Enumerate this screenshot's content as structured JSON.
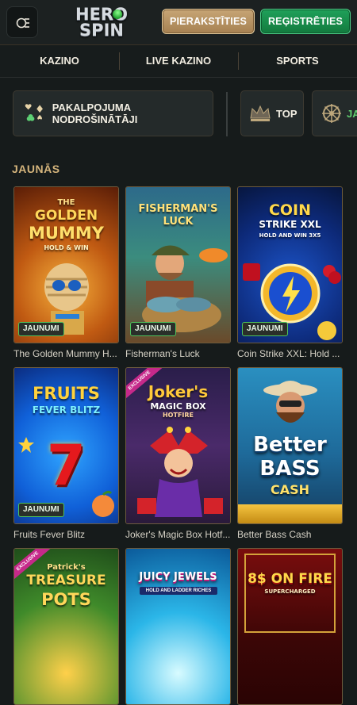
{
  "header": {
    "login_label": "PIERAKSTĪTIES",
    "register_label": "REĢISTRĒTIES",
    "logo_line1": "HERO",
    "logo_line2": "SPIN"
  },
  "nav": {
    "items": [
      {
        "label": "KAZINO"
      },
      {
        "label": "LIVE KAZINO"
      },
      {
        "label": "SPORTS"
      }
    ]
  },
  "categories": [
    {
      "label": "PAKALPOJUMA NODROŠINĀTĀJI",
      "icon": "cards-icon"
    },
    {
      "label": "TOP",
      "icon": "crown-icon"
    },
    {
      "label": "JA",
      "icon": "wheel-icon"
    }
  ],
  "section": {
    "title": "JAUNĀS"
  },
  "badge_new": "JAUNUMI",
  "games": [
    {
      "title": "The Golden Mummy H...",
      "art_line1": "THE",
      "art_line2": "GOLDEN",
      "art_line3": "MUMMY",
      "art_line4": "HOLD & WIN",
      "new": true
    },
    {
      "title": "Fisherman's Luck",
      "art_line1": "FISHERMAN'S",
      "art_line2": "LUCK",
      "new": true
    },
    {
      "title": "Coin Strike XXL: Hold ...",
      "art_line1": "COIN",
      "art_line2": "STRIKE XXL",
      "art_line3": "HOLD AND WIN 3X5",
      "new": true
    },
    {
      "title": "Fruits Fever Blitz",
      "art_line1": "FRUITS",
      "art_line2": "FEVER BLITZ",
      "art_line3": "7",
      "new": true
    },
    {
      "title": "Joker's Magic Box Hotf...",
      "art_line1": "Joker's",
      "art_line2": "MAGIC BOX",
      "art_line3": "HOTFIRE",
      "ribbon": "EXCLUSIVE",
      "new": false
    },
    {
      "title": "Better Bass Cash",
      "art_line1": "Better",
      "art_line2": "BASS",
      "art_line3": "CASH",
      "new": false
    },
    {
      "title": "",
      "art_line1": "Patrick's",
      "art_line2": "TREASURE",
      "art_line3": "POTS",
      "ribbon": "EXCLUSIVE"
    },
    {
      "title": "",
      "art_line1": "JUICY JEWELS",
      "art_line2": "HOLD AND LADDER RICHES"
    },
    {
      "title": "",
      "art_line1": "8$ ON FIRE",
      "art_line2": "SUPERCHARGED"
    }
  ]
}
